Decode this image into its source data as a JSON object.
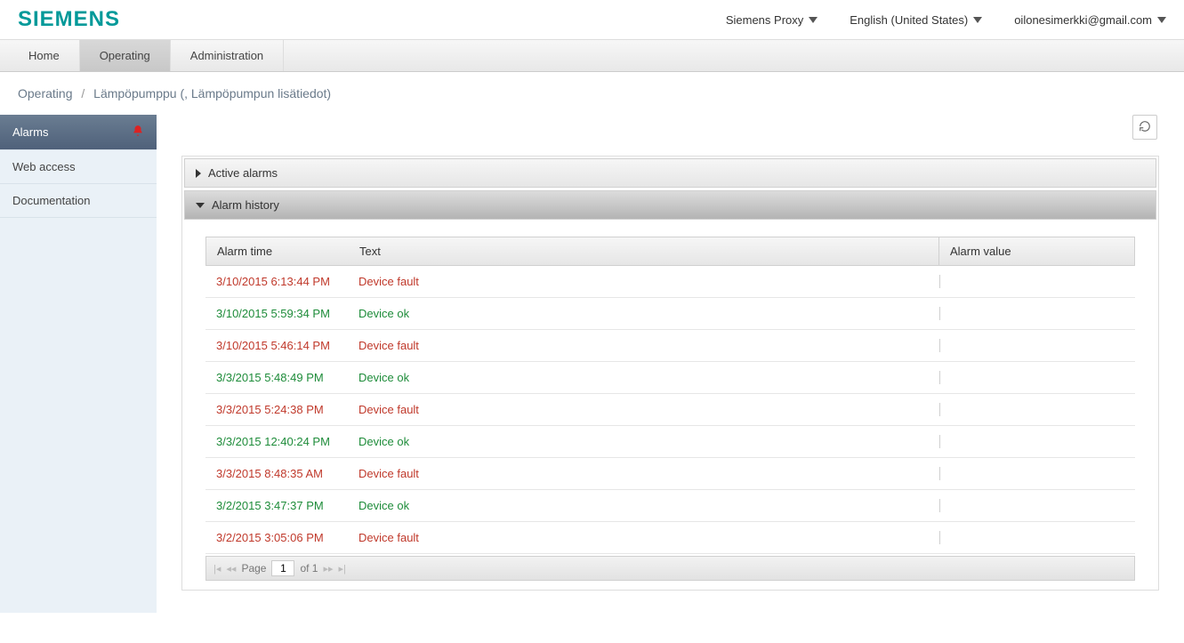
{
  "header": {
    "logo": "SIEMENS",
    "proxy": "Siemens Proxy",
    "language": "English (United States)",
    "user": "oilonesimerkki@gmail.com"
  },
  "nav": {
    "home": "Home",
    "operating": "Operating",
    "administration": "Administration"
  },
  "breadcrumb": {
    "part1": "Operating",
    "part2": "Lämpöpumppu (, Lämpöpumpun lisätiedot)"
  },
  "sidebar": {
    "alarms": "Alarms",
    "web_access": "Web access",
    "documentation": "Documentation"
  },
  "panels": {
    "active_alarms": "Active alarms",
    "alarm_history": "Alarm history"
  },
  "table": {
    "headers": {
      "time": "Alarm time",
      "text": "Text",
      "value": "Alarm value"
    },
    "rows": [
      {
        "time": "3/10/2015 6:13:44 PM",
        "text": "Device fault",
        "value": "",
        "status": "fault"
      },
      {
        "time": "3/10/2015 5:59:34 PM",
        "text": "Device ok",
        "value": "",
        "status": "ok"
      },
      {
        "time": "3/10/2015 5:46:14 PM",
        "text": "Device fault",
        "value": "",
        "status": "fault"
      },
      {
        "time": "3/3/2015 5:48:49 PM",
        "text": "Device ok",
        "value": "",
        "status": "ok"
      },
      {
        "time": "3/3/2015 5:24:38 PM",
        "text": "Device fault",
        "value": "",
        "status": "fault"
      },
      {
        "time": "3/3/2015 12:40:24 PM",
        "text": "Device ok",
        "value": "",
        "status": "ok"
      },
      {
        "time": "3/3/2015 8:48:35 AM",
        "text": "Device fault",
        "value": "",
        "status": "fault"
      },
      {
        "time": "3/2/2015 3:47:37 PM",
        "text": "Device ok",
        "value": "",
        "status": "ok"
      },
      {
        "time": "3/2/2015 3:05:06 PM",
        "text": "Device fault",
        "value": "",
        "status": "fault"
      }
    ]
  },
  "pager": {
    "page_label": "Page",
    "page_value": "1",
    "of_label": "of 1"
  }
}
